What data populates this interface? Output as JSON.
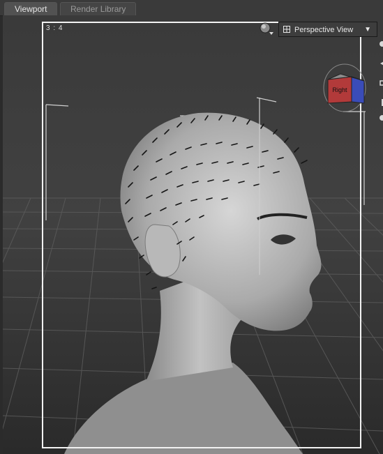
{
  "tabs": [
    {
      "label": "Viewport",
      "active": true
    },
    {
      "label": "Render Library",
      "active": false
    }
  ],
  "viewport": {
    "aspect_ratio": "3 : 4",
    "view_selector": {
      "label": "Perspective View",
      "chevron": "▼"
    },
    "nav_cube": {
      "face_label": "Right"
    }
  },
  "icons": [
    "grid-icon",
    "sphere-control-icon",
    "chevron-down-icon",
    "nav-cube-icon",
    "tool-icon"
  ],
  "colors": {
    "tab_bar": "#3a3a3a",
    "viewport_bg": "#1f1f1f",
    "safe_frame": "#f2f2f2",
    "cube_red": "#b23a3a",
    "cube_blue": "#3a4cb8"
  }
}
